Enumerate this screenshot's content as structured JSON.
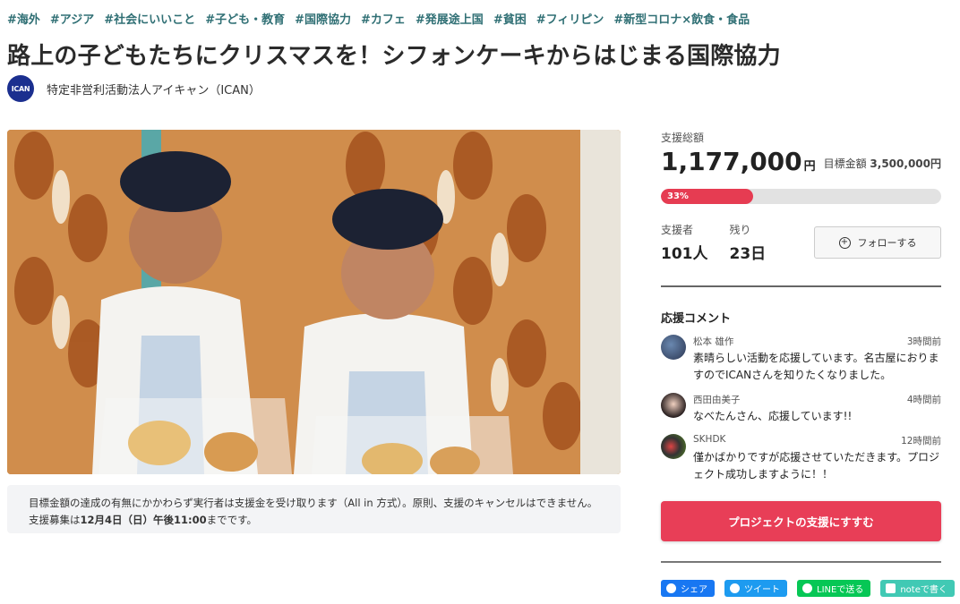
{
  "tags": [
    "#海外",
    "#アジア",
    "#社会にいいこと",
    "#子ども・教育",
    "#国際協力",
    "#カフェ",
    "#発展途上国",
    "#貧困",
    "#フィリピン",
    "#新型コロナ×飲食・食品"
  ],
  "title": "路上の子どもたちにクリスマスを！シフォンケーキからはじまる国際協力",
  "owner": {
    "logo_text": "ICAN",
    "name": "特定非営利活動法人アイキャン（ICAN）"
  },
  "notice": {
    "text_before": "目標金額の達成の有無にかかわらず実行者は支援金を受け取ります（All in 方式）。原則、支援のキャンセルはできません。支援募集は",
    "deadline": "12月4日（日）午後11:00",
    "text_after": "までです。"
  },
  "funding": {
    "total_label": "支援総額",
    "total_amount": "1,177,000",
    "currency": "円",
    "goal_label": "目標金額",
    "goal_amount": "3,500,000円",
    "progress_text": "33%",
    "progress_fraction": 0.33,
    "supporters_label": "支援者",
    "supporters_value": "101人",
    "remaining_label": "残り",
    "remaining_value": "23日",
    "follow_label": "フォローする"
  },
  "comments": {
    "title": "応援コメント",
    "items": [
      {
        "name": "松本 雄作",
        "time": "3時間前",
        "text": "素晴らしい活動を応援しています。名古屋におりますのでICANさんを知りたくなりました。"
      },
      {
        "name": "西田由美子",
        "time": "4時間前",
        "text": "なべたんさん、応援しています!!"
      },
      {
        "name": "SKHDK",
        "time": "12時間前",
        "text": "僅かばかりですが応援させていただきます。プロジェクト成功しますように！！"
      }
    ]
  },
  "support_button": "プロジェクトの支援にすすむ",
  "share": {
    "facebook": "シェア",
    "twitter": "ツイート",
    "line": "LINEで送る",
    "note": "noteで書く"
  },
  "colors": {
    "accent": "#e83e57",
    "progress": "#e63c52",
    "tag": "#2f6f74",
    "facebook": "#1877f2",
    "twitter": "#1d9bf0",
    "line": "#06c755",
    "note": "#41c9b4"
  }
}
